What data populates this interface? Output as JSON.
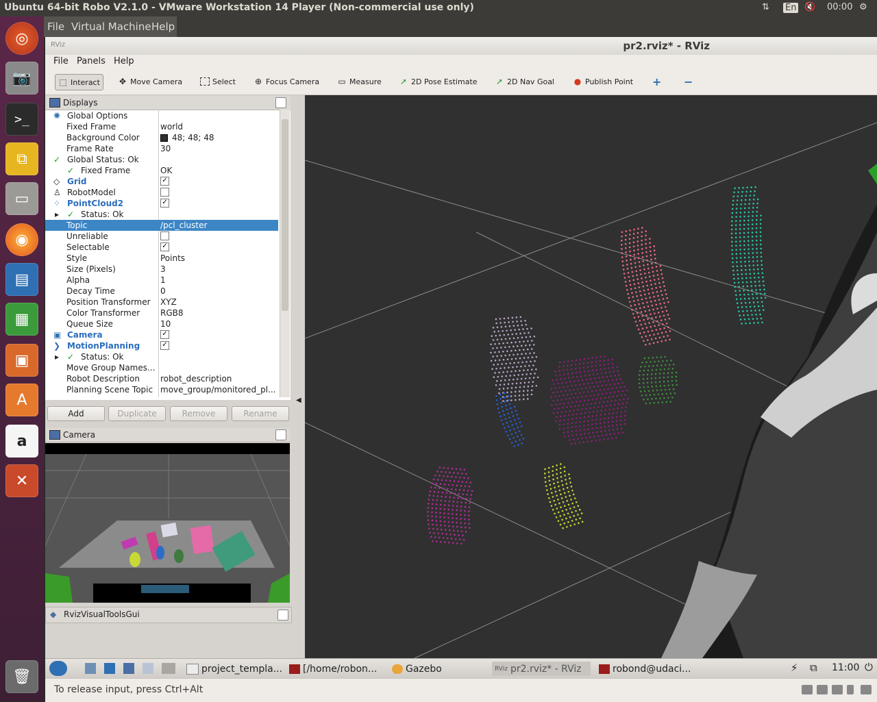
{
  "host": {
    "title": "Ubuntu 64-bit Robo V2.1.0 - VMware Workstation 14 Player (Non-commercial use only)",
    "tray_lang": "En",
    "tray_time": "00:00",
    "menu": [
      "File",
      "Virtual Machine",
      "Help"
    ],
    "status_message": "To release input, press Ctrl+Alt"
  },
  "launcher": [
    "ubuntu-dash-icon",
    "camera-icon",
    "terminal-icon",
    "vmware-tools-icon",
    "files-icon",
    "firefox-icon",
    "writer-icon",
    "calc-icon",
    "impress-icon",
    "software-center-icon",
    "amazon-icon",
    "settings-icon",
    "trash-icon"
  ],
  "rviz": {
    "window_title": "pr2.rviz* - RViz",
    "menu": [
      "File",
      "Panels",
      "Help"
    ],
    "tools": [
      "Interact",
      "Move Camera",
      "Select",
      "Focus Camera",
      "Measure",
      "2D Pose Estimate",
      "2D Nav Goal",
      "Publish Point"
    ],
    "displays_title": "Displays",
    "rows": [
      {
        "name": "Global Options",
        "value": ""
      },
      {
        "name": "Fixed Frame",
        "value": "world"
      },
      {
        "name": "Background Color",
        "value": "48; 48; 48"
      },
      {
        "name": "Frame Rate",
        "value": "30"
      },
      {
        "name": "Global Status: Ok",
        "value": ""
      },
      {
        "name": "Fixed Frame",
        "value": "OK"
      },
      {
        "name": "Grid",
        "value": ""
      },
      {
        "name": "RobotModel",
        "value": ""
      },
      {
        "name": "PointCloud2",
        "value": ""
      },
      {
        "name": "Status: Ok",
        "value": ""
      },
      {
        "name": "Topic",
        "value": "/pcl_cluster"
      },
      {
        "name": "Unreliable",
        "value": ""
      },
      {
        "name": "Selectable",
        "value": ""
      },
      {
        "name": "Style",
        "value": "Points"
      },
      {
        "name": "Size (Pixels)",
        "value": "3"
      },
      {
        "name": "Alpha",
        "value": "1"
      },
      {
        "name": "Decay Time",
        "value": "0"
      },
      {
        "name": "Position Transformer",
        "value": "XYZ"
      },
      {
        "name": "Color Transformer",
        "value": "RGB8"
      },
      {
        "name": "Queue Size",
        "value": "10"
      },
      {
        "name": "Camera",
        "value": ""
      },
      {
        "name": "MotionPlanning",
        "value": ""
      },
      {
        "name": "Status: Ok",
        "value": ""
      },
      {
        "name": "Move Group Names...",
        "value": ""
      },
      {
        "name": "Robot Description",
        "value": "robot_description"
      },
      {
        "name": "Planning Scene Topic",
        "value": "move_group/monitored_pl..."
      }
    ],
    "buttons": [
      "Add",
      "Duplicate",
      "Remove",
      "Rename"
    ],
    "camera_panel_title": "Camera",
    "visual_tools_title": "RvizVisualToolsGui",
    "colors": {
      "background": "#303030",
      "selection": "#3d86c6",
      "category": "#2c6ebd"
    }
  },
  "guest_taskbar": {
    "tasks": [
      "project_templa...",
      "[/home/robon...",
      "Gazebo",
      "pr2.rviz* - RViz",
      "robond@udaci..."
    ],
    "clock": "11:00"
  }
}
